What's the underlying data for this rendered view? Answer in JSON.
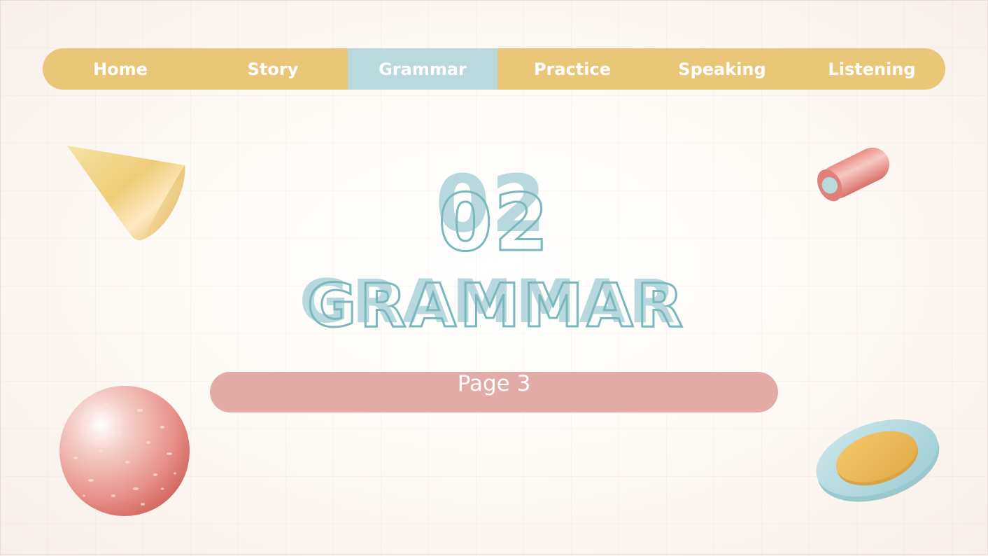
{
  "nav": {
    "items": [
      {
        "label": "Home",
        "active": false
      },
      {
        "label": "Story",
        "active": false
      },
      {
        "label": "Grammar",
        "active": true
      },
      {
        "label": "Practice",
        "active": false
      },
      {
        "label": "Speaking",
        "active": false
      },
      {
        "label": "Listening",
        "active": false
      }
    ]
  },
  "section": {
    "number": "02",
    "title": "GRAMMAR"
  },
  "page": {
    "label": "Page 3"
  },
  "decorations": {
    "cone": "cone-icon",
    "tube": "tube-icon",
    "sphere": "sphere-icon",
    "disc": "disc-icon"
  },
  "colors": {
    "nav_bar": "#eac678",
    "nav_active": "#b9d9dd",
    "title_outline": "#7ab8be",
    "title_shadow": "#b7d8dc",
    "page_pill": "#e3aba5",
    "background": "#fbf6f1"
  }
}
